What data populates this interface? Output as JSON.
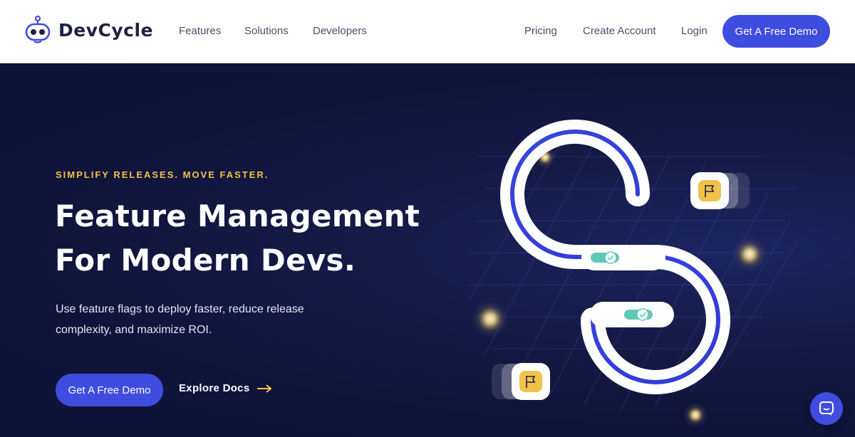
{
  "header": {
    "brand": "DevCycle",
    "nav_left": [
      "Features",
      "Solutions",
      "Developers"
    ],
    "nav_right": [
      "Pricing",
      "Create Account",
      "Login"
    ],
    "cta_label": "Get A Free Demo"
  },
  "hero": {
    "eyebrow": "SIMPLIFY RELEASES. MOVE FASTER.",
    "headline_line1": "Feature Management",
    "headline_line2": "For Modern Devs.",
    "subtext_line1": "Use feature flags to deploy faster, reduce release",
    "subtext_line2": "complexity, and maximize ROI.",
    "primary_cta": "Get A Free Demo",
    "secondary_cta": "Explore Docs"
  },
  "icons": {
    "logo": "robot-logo-icon",
    "arrow": "arrow-right-icon",
    "flag": "flag-icon",
    "check": "check-icon",
    "chat": "chat-bubble-icon"
  },
  "colors": {
    "accent": "#3e4de0",
    "hero_bg": "#10143a",
    "eyebrow": "#f2c14a",
    "flag_badge": "#f2c14a",
    "toggle": "#5fc9b8"
  }
}
